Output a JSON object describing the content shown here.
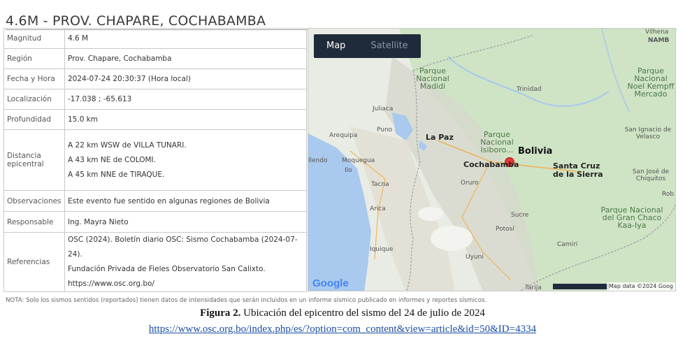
{
  "title": "4.6M - PROV. CHAPARE, COCHABAMBA",
  "rows": [
    {
      "key": "Magnitud",
      "value": "4.6 M"
    },
    {
      "key": "Región",
      "value": "Prov. Chapare, Cochabamba"
    },
    {
      "key": "Fecha y Hora",
      "value": "2024-07-24 20:30:37 (Hora local)"
    },
    {
      "key": "Localización",
      "value": "-17.038 ; -65.613"
    },
    {
      "key": "Profundidad",
      "value": "15.0 km"
    }
  ],
  "distance": {
    "key": "Distancia epicentral",
    "lines": [
      "A 22 km WSW de VILLA TUNARI.",
      "A 43 km NE de COLOMI.",
      "A 45 km NNE de TIRAQUE."
    ]
  },
  "observations": {
    "key": "Observaciones",
    "value": "Este evento fue sentido en algunas regiones de Bolivia"
  },
  "responsible": {
    "key": "Responsable",
    "value": "Ing. Mayra Nieto"
  },
  "references": {
    "key": "Referencias",
    "lines": [
      "OSC (2024). Boletín diario OSC: Sismo Cochabamba (2024-07-24).",
      "Fundación Privada de Fieles Observatorio San Calixto.",
      "https://www.osc.org.bo/"
    ]
  },
  "map": {
    "tab_map": "Map",
    "tab_satellite": "Satellite",
    "labels": {
      "vilhena": "Vilhena",
      "namb": "NAMB",
      "parque_madidi": "Parque Nacional Madidi",
      "parque_noel": "Parque Nacional Noel Kempff Mercado",
      "trinidad": "Trinidad",
      "juliaca": "Juliaca",
      "puno": "Puno",
      "arequipa": "Arequipa",
      "la_paz": "La Paz",
      "parque_isiboro": "Parque Nacional Isiboro...",
      "bolivia": "Bolivia",
      "san_ignacio": "San Ignacio de Velasco",
      "moquegua": "Moquegua",
      "ilo": "Ilo",
      "cochabamba": "Cochabamba",
      "santa_cruz": "Santa Cruz de la Sierra",
      "san_jose": "San José de Chiquitos",
      "tacna": "Tacna",
      "oruro": "Oruro",
      "arica": "Arica",
      "sucre": "Sucre",
      "potosi": "Potosí",
      "parque_gran_chaco": "Parque Nacional del Gran Chaco Kaa-Iya",
      "iquique": "Iquique",
      "uyuni": "Uyuni",
      "camiri": "Camiri",
      "tarija": "Tarija",
      "lendo": "llendo",
      "rob": "Rob"
    },
    "google": "Google",
    "attribution": "Map data ©2024 Goog",
    "colors": {
      "water": "#a9c9ee",
      "land": "#e9ece4",
      "green": "#cfe3c5",
      "pin": "#e53935"
    }
  },
  "note": "NOTA: Solo los sismos sentidos (reportados) tienen datos de intensidades que serán incluidos en un informe sísmico publicado en informes y reportes sísmicos.",
  "caption": {
    "figure_label": "Figura 2.",
    "figure_text": " Ubicación del epicentro del sismo del 24 de julio de 2024",
    "link": "https://www.osc.org.bo/index.php/es/?option=com_content&view=article&id=50&ID=4334"
  }
}
